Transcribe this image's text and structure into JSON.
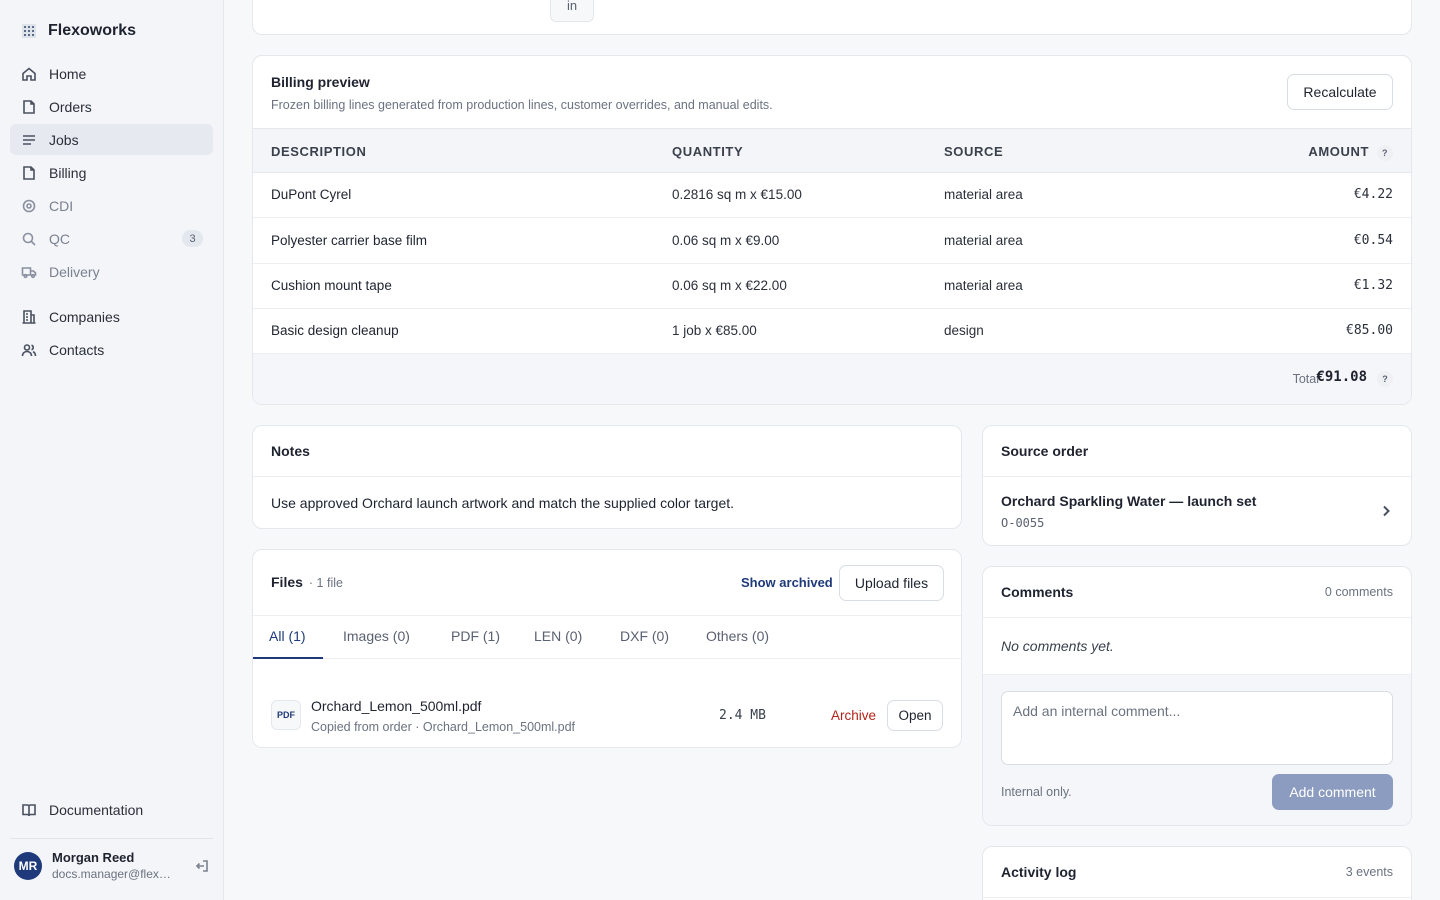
{
  "brand": {
    "name": "Flexoworks",
    "icon": "building-logo-icon"
  },
  "sidebar": {
    "items": [
      {
        "label": "Home",
        "icon": "home-icon",
        "state": "normal"
      },
      {
        "label": "Orders",
        "icon": "document-icon",
        "state": "normal"
      },
      {
        "label": "Jobs",
        "icon": "list-icon",
        "state": "active"
      },
      {
        "label": "Billing",
        "icon": "document-icon",
        "state": "normal"
      },
      {
        "label": "CDI",
        "icon": "target-icon",
        "state": "muted"
      },
      {
        "label": "QC",
        "icon": "search-icon",
        "state": "muted",
        "badge": "3"
      },
      {
        "label": "Delivery",
        "icon": "truck-icon",
        "state": "muted"
      },
      {
        "label": "Companies",
        "icon": "building-icon",
        "state": "normal"
      },
      {
        "label": "Contacts",
        "icon": "users-icon",
        "state": "normal"
      }
    ],
    "documentation": "Documentation",
    "user": {
      "initials": "MR",
      "name": "Morgan Reed",
      "email": "docs.manager@flexoworks.com"
    }
  },
  "top_card": {
    "chip": "in"
  },
  "billing": {
    "title": "Billing preview",
    "subtitle": "Frozen billing lines generated from production lines, customer overrides, and manual edits.",
    "recalculate": "Recalculate",
    "columns": {
      "description": "DESCRIPTION",
      "quantity": "QUANTITY",
      "source": "SOURCE",
      "amount": "AMOUNT"
    },
    "rows": [
      {
        "description": "DuPont Cyrel",
        "quantity": "0.2816 sq m x €15.00",
        "source": "material area",
        "amount": "€4.22"
      },
      {
        "description": "Polyester carrier base film",
        "quantity": "0.06 sq m x €9.00",
        "source": "material area",
        "amount": "€0.54"
      },
      {
        "description": "Cushion mount tape",
        "quantity": "0.06 sq m x €22.00",
        "source": "material area",
        "amount": "€1.32"
      },
      {
        "description": "Basic design cleanup",
        "quantity": "1 job x €85.00",
        "source": "design",
        "amount": "€85.00"
      }
    ],
    "total_label": "Total",
    "total_value": "€91.08",
    "help": "?"
  },
  "notes": {
    "title": "Notes",
    "text": "Use approved Orchard launch artwork and match the supplied color target."
  },
  "files": {
    "title": "Files",
    "count": "· 1 file",
    "show_archived": "Show archived",
    "upload": "Upload files",
    "tabs": [
      "All (1)",
      "Images (0)",
      "PDF (1)",
      "LEN (0)",
      "DXF (0)",
      "Others (0)"
    ],
    "active_tab": "All (1)",
    "file": {
      "type": "PDF",
      "name": "Orchard_Lemon_500ml.pdf",
      "meta": "Copied from order · Orchard_Lemon_500ml.pdf",
      "size": "2.4 MB",
      "archive": "Archive",
      "open": "Open"
    }
  },
  "source_order": {
    "title": "Source order",
    "name": "Orchard Sparkling Water — launch set",
    "code": "O-0055"
  },
  "comments": {
    "title": "Comments",
    "count": "0 comments",
    "empty": "No comments yet.",
    "placeholder": "Add an internal comment...",
    "internal": "Internal only.",
    "add": "Add comment"
  },
  "activity": {
    "title": "Activity log",
    "count": "3 events"
  },
  "colors": {
    "accent": "#1f3a7a",
    "danger": "#b42318",
    "disabled_button": "#8b9cc0"
  }
}
